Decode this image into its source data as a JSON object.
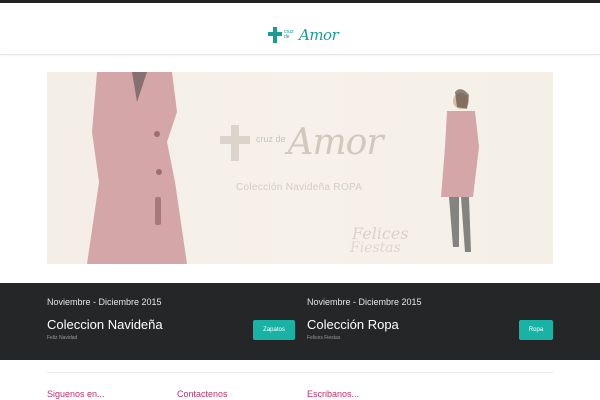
{
  "header": {
    "logo_small": "cruz de",
    "logo_script": "Amor"
  },
  "banner": {
    "logo_small": "cruz de",
    "logo_script": "Amor",
    "subtitle": "Colección Navideña ROPA",
    "felices": "Felices",
    "fiestas": "Fiestas"
  },
  "promos": [
    {
      "date": "Noviembre - Diciembre 2015",
      "title": "Coleccion Navideña",
      "subtitle": "Feliz Navidad",
      "button": "Zapatos"
    },
    {
      "date": "Noviembre - Diciembre 2015",
      "title": "Colección Ropa",
      "subtitle": "Felices Fiestas",
      "button": "Ropa"
    }
  ],
  "footer": {
    "col1": "Siguenos en...",
    "col2": "Contactenos",
    "col3": "Escribanos..."
  },
  "colors": {
    "accent": "#19b3a6",
    "brand": "#1a9c93",
    "footer_heading": "#c0306a",
    "promo_bg": "#252627"
  }
}
